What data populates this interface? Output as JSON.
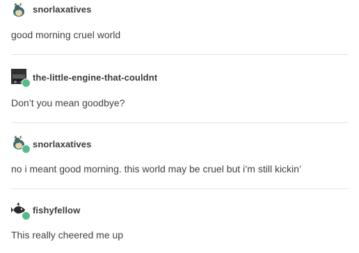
{
  "posts": [
    {
      "username": "snorlaxatives",
      "text": "good morning cruel world",
      "avatar_icon": "snorlax-avatar-icon",
      "reblog": false
    },
    {
      "username": "the-little-engine-that-couldnt",
      "text": "Don’t you mean goodbye?",
      "avatar_icon": "train-avatar-icon",
      "reblog": true
    },
    {
      "username": "snorlaxatives",
      "text": "no i meant good morning. this world may be cruel but i’m still kickin’",
      "avatar_icon": "snorlax-avatar-icon",
      "reblog": true
    },
    {
      "username": "fishyfellow",
      "text": "This really cheered me up",
      "avatar_icon": "fish-avatar-icon",
      "reblog": true
    }
  ],
  "colors": {
    "reblog_badge": "#56bc8a",
    "divider": "#e3e3e3"
  }
}
